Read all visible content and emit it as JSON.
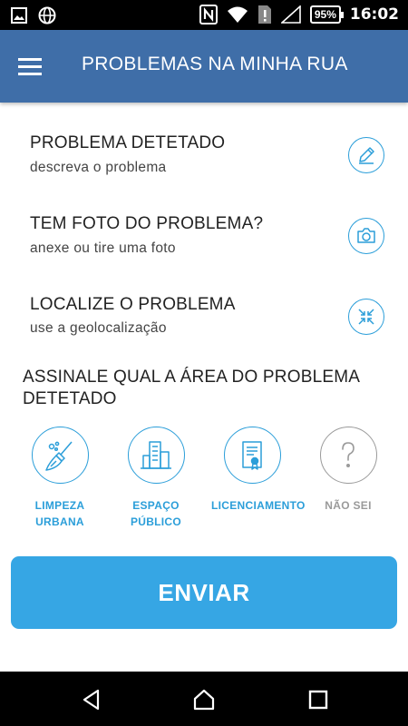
{
  "status_bar": {
    "time": "16:02",
    "battery": "95%",
    "icons": [
      "image-icon",
      "globe-icon",
      "nfc-icon",
      "wifi-icon",
      "sim-alert-icon",
      "signal-icon",
      "battery-icon"
    ]
  },
  "app_bar": {
    "title": "PROBLEMAS NA MINHA RUA",
    "menu_icon": "hamburger-menu-icon"
  },
  "rows": [
    {
      "title": "PROBLEMA DETETADO",
      "subtitle": "descreva o problema",
      "icon": "pencil-icon"
    },
    {
      "title": "TEM FOTO DO PROBLEMA?",
      "subtitle": "anexe ou tire uma foto",
      "icon": "camera-icon"
    },
    {
      "title": "LOCALIZE O PROBLEMA",
      "subtitle": "use a geolocalização",
      "icon": "locate-arrows-icon"
    }
  ],
  "area_section": {
    "heading": "ASSINALE QUAL A ÁREA DO PROBLEMA DETETADO",
    "options": [
      {
        "line1": "LIMPEZA",
        "line2": "URBANA",
        "icon": "broom-icon",
        "color": "#2b9ed9"
      },
      {
        "line1": "ESPAÇO",
        "line2": "PÚBLICO",
        "icon": "buildings-icon",
        "color": "#2b9ed9"
      },
      {
        "line1": "LICENCIAMENTO",
        "line2": "",
        "icon": "certificate-icon",
        "color": "#2b9ed9"
      },
      {
        "line1": "NÃO SEI",
        "line2": "",
        "icon": "question-icon",
        "color": "#9a9a9a"
      }
    ]
  },
  "submit": {
    "label": "ENVIAR"
  },
  "colors": {
    "app_bar": "#3f6ea8",
    "accent": "#2b9ed9",
    "button": "#36a6e4",
    "inactive": "#9a9a9a"
  },
  "nav_bar": {
    "icons": [
      "back-icon",
      "home-icon",
      "recents-icon"
    ]
  }
}
